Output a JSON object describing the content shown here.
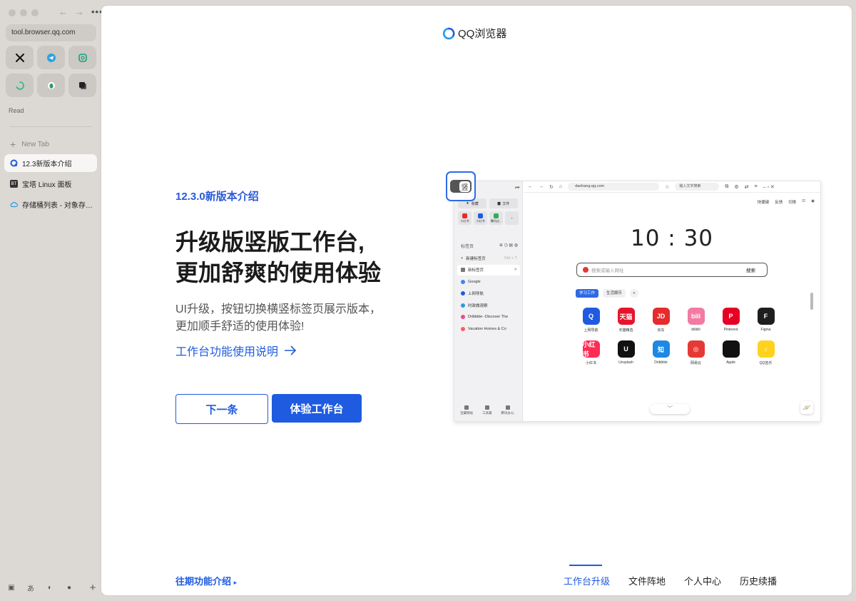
{
  "sidebar": {
    "nav": {
      "back": "←",
      "forward": "→",
      "more": "•••"
    },
    "url": "tool.browser.qq.com",
    "pinned": [
      {
        "name": "x",
        "icon": "x-logo-icon",
        "color": "#111111"
      },
      {
        "name": "telegram",
        "icon": "telegram-icon",
        "color": "#2AA3DF"
      },
      {
        "name": "chatgpt",
        "icon": "chatgpt-icon",
        "color": "#10A37F"
      },
      {
        "name": "loading",
        "icon": "spinner-icon",
        "color": "#19B98B"
      },
      {
        "name": "leaf",
        "icon": "leaf-icon",
        "color": "#2E9E5B"
      },
      {
        "name": "stack",
        "icon": "stack-icon",
        "color": "#333333"
      }
    ],
    "read_label": "Read",
    "new_tab_label": "New Tab",
    "tabs": [
      {
        "label": "12.3新版本介绍",
        "active": true,
        "icon": "qq-browser-icon",
        "color": "#1F5BE0"
      },
      {
        "label": "宝塔 Linux 面板",
        "active": false,
        "icon": "bt-icon",
        "color": "#333333"
      },
      {
        "label": "存储桶列表 - 对象存储 - 控制台",
        "active": false,
        "icon": "cloud-icon",
        "color": "#2A9BE0"
      }
    ]
  },
  "page": {
    "brand": "QQ浏览器",
    "version_title": "12.3.0新版本介绍",
    "headline_line1": "升级版竖版工作台,",
    "headline_line2": "更加舒爽的使用体验",
    "desc_line1": "UI升级，按钮切换横竖标签页展示版本，",
    "desc_line2": "更加顺手舒适的使用体验!",
    "guide_link": "工作台功能使用说明",
    "btn_next": "下一条",
    "btn_try": "体验工作台",
    "history_link": "往期功能介绍",
    "bottom_tabs": [
      {
        "label": "工作台升级",
        "active": true
      },
      {
        "label": "文件阵地",
        "active": false
      },
      {
        "label": "个人中心",
        "active": false
      },
      {
        "label": "历史续播",
        "active": false
      }
    ],
    "accent_color": "#1F5BE0"
  },
  "preview": {
    "toggle_char": "竖",
    "quick": [
      "收藏",
      "文件"
    ],
    "mini_apps": [
      {
        "label": "小红书",
        "color": "#E82A2A"
      },
      {
        "label": "小红书",
        "color": "#1F5BE0"
      },
      {
        "label": "腾讯达...",
        "color": "#2EAE5B"
      }
    ],
    "tab_section": "标签页",
    "new_tab": "新建标签页",
    "new_tab_shortcut": "Ctrl + T",
    "tabs": [
      {
        "label": "新标签页",
        "color": "#777777",
        "active": true
      },
      {
        "label": "Google",
        "color": "#4285F4",
        "active": false
      },
      {
        "label": "上网导航",
        "color": "#1F5BE0",
        "active": false
      },
      {
        "label": "时政微观察",
        "color": "#2A9BE0",
        "active": false
      },
      {
        "label": "Dribbble -Discover The",
        "color": "#EA4C89",
        "active": false
      },
      {
        "label": "Vacation Homes & Co",
        "color": "#FF5A5F",
        "active": false
      }
    ],
    "side_bottom": [
      "宝藏网站",
      "工具箱",
      "腾讯办公"
    ],
    "address": "daohang.qq.com",
    "search_small": "输入文字搜索",
    "right_tools": [
      "快捷键",
      "反馈",
      "切换"
    ],
    "clock": "10 : 30",
    "search_placeholder": "搜索或输入网址",
    "search_button": "搜索",
    "categories": [
      "学习工作",
      "生活娱乐",
      "+"
    ],
    "apps": [
      {
        "label": "上网导航",
        "glyph": "Q",
        "color": "#1F5BE0"
      },
      {
        "label": "天猫精选",
        "glyph": "天猫",
        "color": "#E5142A"
      },
      {
        "label": "京东",
        "glyph": "JD",
        "color": "#E52B2B"
      },
      {
        "label": "bilibili",
        "glyph": "bili",
        "color": "#F27BA3"
      },
      {
        "label": "Pinterest",
        "glyph": "P",
        "color": "#E60023"
      },
      {
        "label": "Figma",
        "glyph": "F",
        "color": "#1E1E1E"
      },
      {
        "label": "小红书",
        "glyph": "小红书",
        "color": "#FE2C55"
      },
      {
        "label": "Unsplash",
        "glyph": "U",
        "color": "#111111"
      },
      {
        "label": "Dribbble",
        "glyph": "知",
        "color": "#1E88E5"
      },
      {
        "label": "网易云",
        "glyph": "◎",
        "color": "#E53935"
      },
      {
        "label": "Apple",
        "glyph": "",
        "color": "#111111"
      },
      {
        "label": "QQ音乐",
        "glyph": "♪",
        "color": "#FFD21F"
      }
    ]
  }
}
